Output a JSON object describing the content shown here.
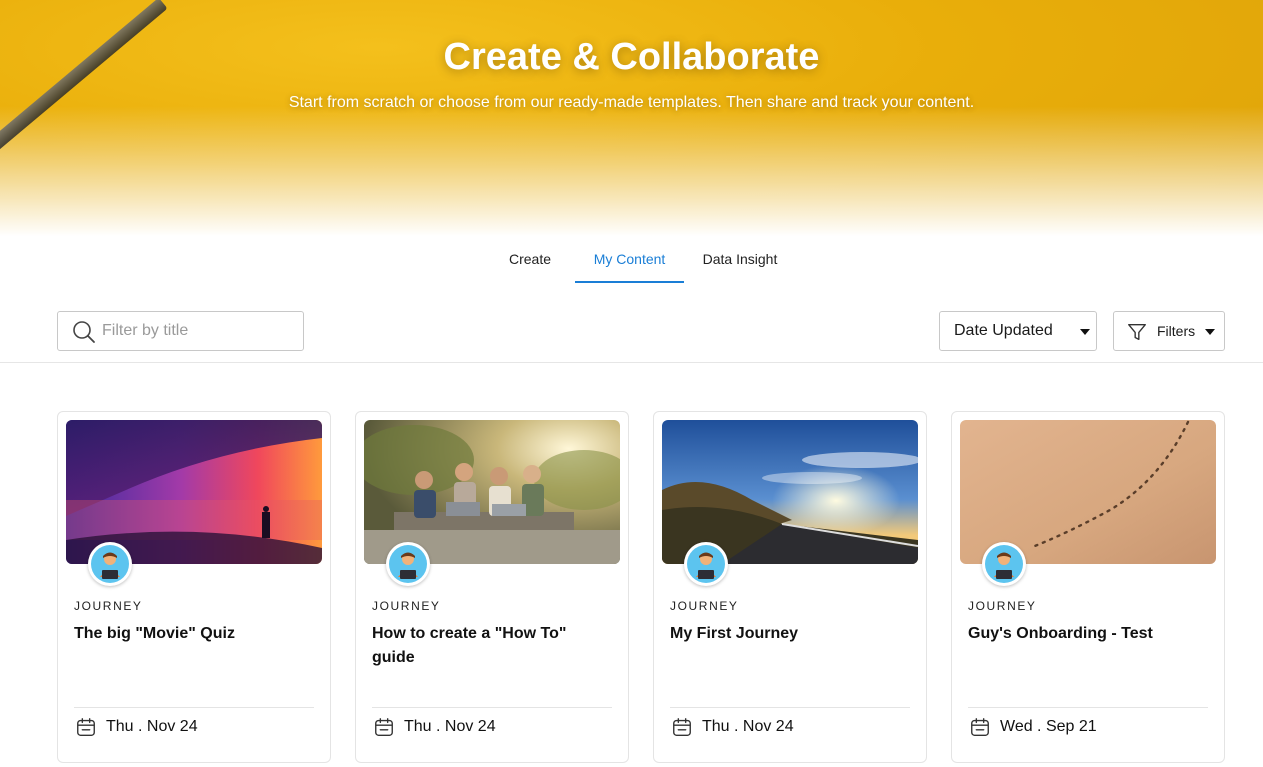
{
  "hero": {
    "title": "Create & Collaborate",
    "subtitle": "Start from scratch or choose from our ready-made templates. Then share and track your content."
  },
  "tabs": [
    {
      "label": "Create",
      "active": false
    },
    {
      "label": "My Content",
      "active": true
    },
    {
      "label": "Data Insight",
      "active": false
    }
  ],
  "toolbar": {
    "search_placeholder": "Filter by title",
    "search_value": "",
    "sort_label": "Date Updated",
    "filters_label": "Filters"
  },
  "colors": {
    "accent": "#1a7ed6",
    "hero_yellow": "#e9ae0a"
  },
  "cards": [
    {
      "type": "JOURNEY",
      "title": "The big \"Movie\" Quiz",
      "date": "Thu . Nov 24",
      "image": "purple-glass-corridor"
    },
    {
      "type": "JOURNEY",
      "title": "How to create a \"How To\" guide",
      "date": "Thu . Nov 24",
      "image": "friends-with-laptops"
    },
    {
      "type": "JOURNEY",
      "title": "My First Journey",
      "date": "Thu . Nov 24",
      "image": "road-at-sunset"
    },
    {
      "type": "JOURNEY",
      "title": "Guy's Onboarding - Test",
      "date": "Wed . Sep 21",
      "image": "footprints-in-sand"
    }
  ]
}
